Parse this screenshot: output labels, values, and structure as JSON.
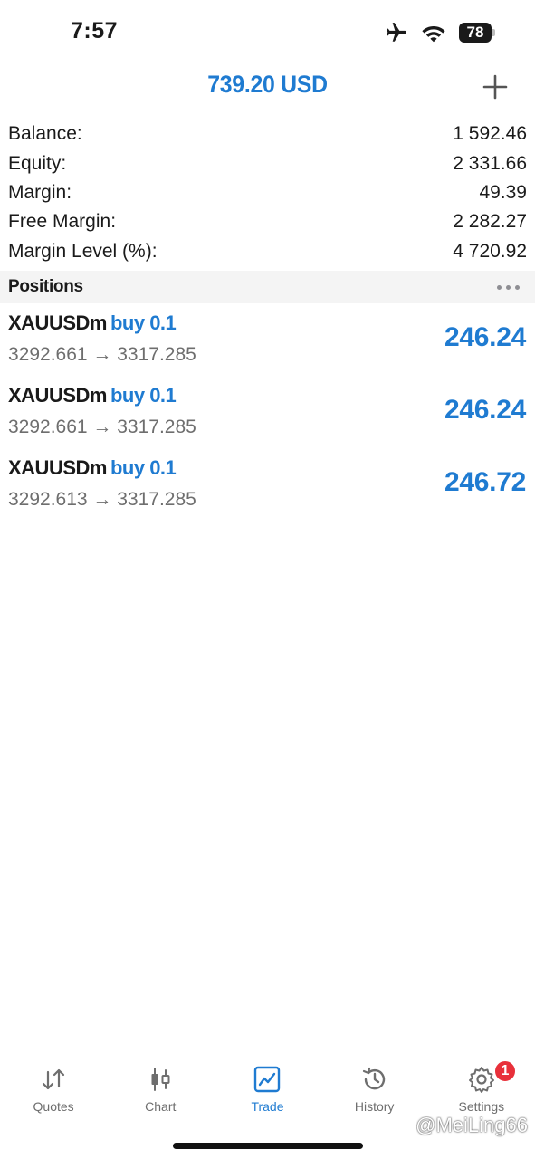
{
  "status_bar": {
    "time": "7:57",
    "battery": "78",
    "icons": [
      "airplane-icon",
      "wifi-icon",
      "battery-icon"
    ]
  },
  "header": {
    "title": "739.20 USD",
    "add_icon": "plus-icon"
  },
  "summary": [
    {
      "label": "Balance:",
      "value": "1 592.46"
    },
    {
      "label": "Equity:",
      "value": "2 331.66"
    },
    {
      "label": "Margin:",
      "value": "49.39"
    },
    {
      "label": "Free Margin:",
      "value": "2 282.27"
    },
    {
      "label": "Margin Level (%):",
      "value": "4 720.92"
    }
  ],
  "positions": {
    "title": "Positions",
    "items": [
      {
        "symbol": "XAUUSDm",
        "type": "buy 0.1",
        "prices": "3292.661 → 3317.285",
        "profit": "246.24"
      },
      {
        "symbol": "XAUUSDm",
        "type": "buy 0.1",
        "prices": "3292.661 → 3317.285",
        "profit": "246.24"
      },
      {
        "symbol": "XAUUSDm",
        "type": "buy 0.1",
        "prices": "3292.613 → 3317.285",
        "profit": "246.72"
      }
    ]
  },
  "tabs": [
    {
      "label": "Quotes",
      "icon": "quotes-icon",
      "active": false
    },
    {
      "label": "Chart",
      "icon": "chart-icon",
      "active": false
    },
    {
      "label": "Trade",
      "icon": "trade-icon",
      "active": true
    },
    {
      "label": "History",
      "icon": "history-icon",
      "active": false
    },
    {
      "label": "Settings",
      "icon": "settings-icon",
      "active": false,
      "badge": "1"
    }
  ],
  "watermark": "@MeiLing66",
  "colors": {
    "accent": "#1f7bd1",
    "text": "#1a1a1a",
    "secondary_text": "#6e6e6e",
    "section_bg": "#f4f4f4",
    "badge": "#e8303a"
  }
}
